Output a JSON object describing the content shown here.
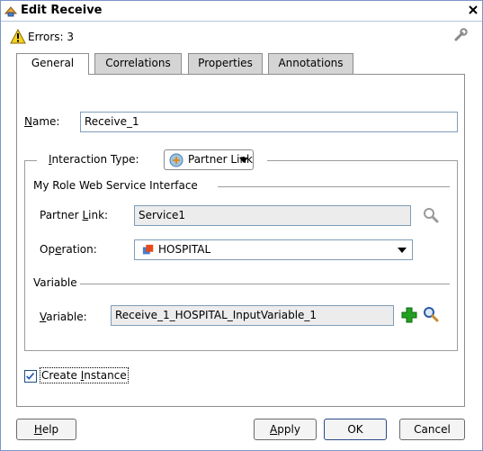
{
  "title": "Edit Receive",
  "errors_text": "Errors: 3",
  "tabs": [
    {
      "label": "General",
      "active": true
    },
    {
      "label": "Correlations",
      "active": false
    },
    {
      "label": "Properties",
      "active": false
    },
    {
      "label": "Annotations",
      "active": false
    }
  ],
  "name": {
    "label_first": "N",
    "label_rest": "ame:",
    "value": "Receive_1"
  },
  "interaction_type": {
    "label_first": "I",
    "label_rest": "nteraction Type:",
    "value": "Partner Link"
  },
  "my_role": {
    "heading": "My Role Web Service Interface"
  },
  "partner_link": {
    "label_pre": "Partner ",
    "label_u": "L",
    "label_post": "ink:",
    "value": "Service1"
  },
  "operation": {
    "label_pre": "Op",
    "label_u": "e",
    "label_post": "ration:",
    "value": "HOSPITAL"
  },
  "variable_section": {
    "heading": "Variable"
  },
  "variable": {
    "label_u": "V",
    "label_rest": "ariable:",
    "value": "Receive_1_HOSPITAL_InputVariable_1"
  },
  "create_instance": {
    "label_pre": "Create ",
    "label_u": "I",
    "label_post": "nstance",
    "checked": true
  },
  "buttons": {
    "help_u": "H",
    "help_rest": "elp",
    "apply_u": "A",
    "apply_rest": "pply",
    "ok": "OK",
    "cancel": "Cancel"
  },
  "colors": {
    "title_border": "#7a96c8",
    "tab_inactive": "#d4d4d4",
    "add_green": "#22a022"
  }
}
